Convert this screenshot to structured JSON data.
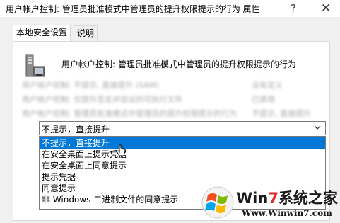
{
  "window": {
    "title": "用户帐户控制: 管理员批准模式中管理员的提升权限提示的行为 属性",
    "help_glyph": "?",
    "close_glyph": "✕"
  },
  "tabs": [
    {
      "label": "本地安全设置",
      "active": true
    },
    {
      "label": "说明",
      "active": false
    }
  ],
  "policy": {
    "title": "用户帐户控制: 管理员批准模式中管理员的提升权限提示的行为",
    "icon": "policy-server-icon"
  },
  "background_rows": [
    {
      "col1": "用户帐户控制: 不提示, 直接提升 (SAM)",
      "col2": "没有定义"
    },
    {
      "col1": "用户帐户控制: 仅提升签名并验证的可执行文件",
      "col2": "已禁用"
    },
    {
      "col1": "用户帐户控制: 管理员批准模式中管理员的提升权限提示的行为",
      "col2": "不提示, 直接提升"
    }
  ],
  "combo": {
    "selected_value": "不提示，直接提升",
    "chevron_icon": "chevron-down-icon"
  },
  "dropdown": {
    "options": [
      {
        "label": "不提示，直接提升",
        "highlighted": true
      },
      {
        "label": "在安全桌面上提示凭据",
        "highlighted": false
      },
      {
        "label": "在安全桌面上同意提示",
        "highlighted": false
      },
      {
        "label": "提示凭据",
        "highlighted": false
      },
      {
        "label": "同意提示",
        "highlighted": false
      },
      {
        "label": "非 Windows 二进制文件的同意提示",
        "highlighted": false
      }
    ]
  },
  "watermark": {
    "brand_prefix": "Win",
    "brand_number": "7",
    "brand_suffix": "系统之家",
    "url": "Www.Winwin7.com"
  },
  "colors": {
    "selection": "#0078d7",
    "brand_red": "#e5262b"
  }
}
